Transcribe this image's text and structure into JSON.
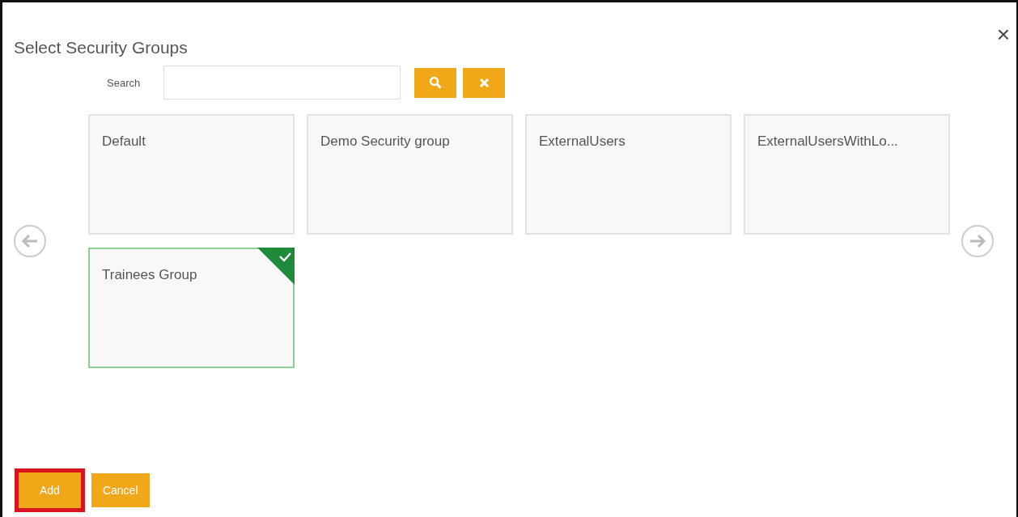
{
  "dialog": {
    "title": "Select Security Groups",
    "close": "×"
  },
  "search": {
    "label": "Search"
  },
  "groups": [
    {
      "name": "Default",
      "selected": false
    },
    {
      "name": "Demo Security group",
      "selected": false
    },
    {
      "name": "ExternalUsers",
      "selected": false
    },
    {
      "name": "ExternalUsersWithLo...",
      "selected": false
    },
    {
      "name": "Trainees Group",
      "selected": true
    }
  ],
  "buttons": [
    {
      "label": "Add",
      "highlighted": true
    },
    {
      "label": "Cancel",
      "highlighted": false
    }
  ]
}
